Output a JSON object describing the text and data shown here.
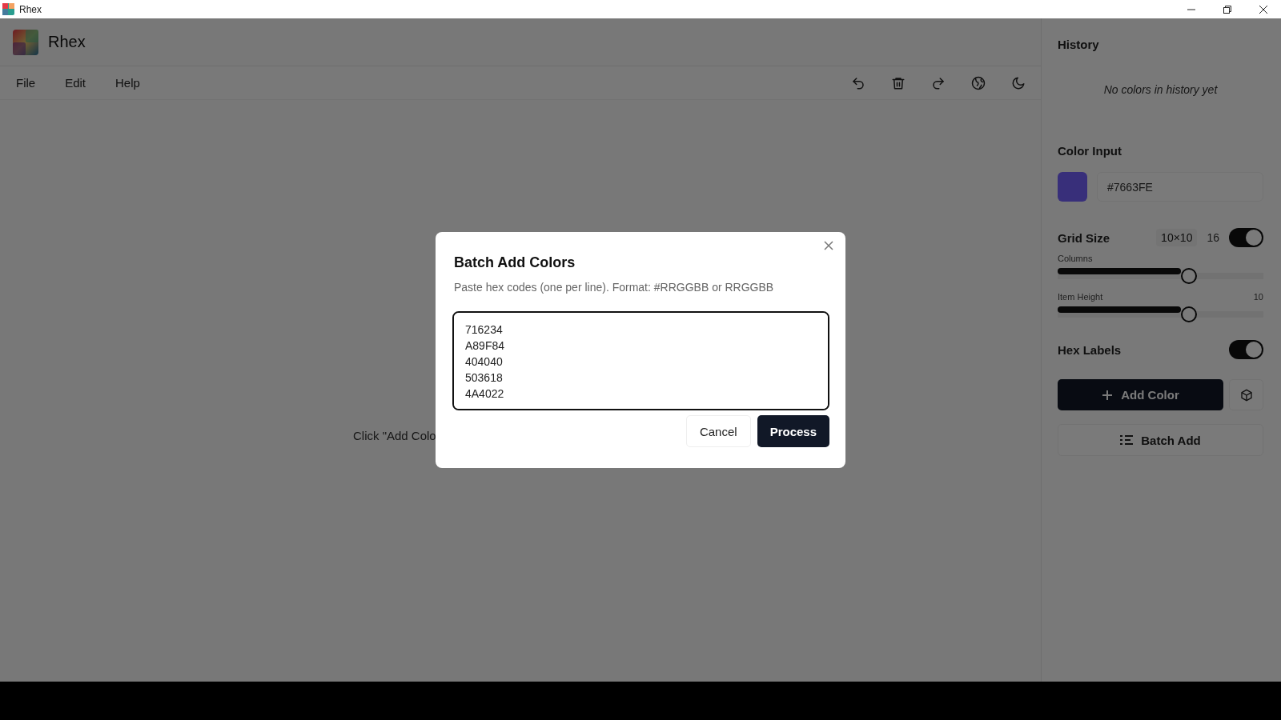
{
  "window": {
    "title": "Rhex"
  },
  "app": {
    "title": "Rhex"
  },
  "menu": [
    {
      "label": "File"
    },
    {
      "label": "Edit"
    },
    {
      "label": "Help"
    }
  ],
  "main": {
    "hint": "Click \"Add Colo"
  },
  "sidebar": {
    "history": {
      "title": "History",
      "empty": "No colors in history yet"
    },
    "color_input": {
      "label": "Color Input",
      "value": "#7663FE"
    },
    "grid_size": {
      "label": "Grid Size",
      "size": "10×10",
      "count": "16",
      "on": true
    },
    "sliders": [
      {
        "label": "Columns",
        "level": 0.6
      },
      {
        "label": "Item Height",
        "reading": "10",
        "level": 0.6
      }
    ],
    "hex_labels": {
      "label": "Hex Labels",
      "on": true
    },
    "add_button": "Add Color",
    "batch_button": "Batch Add"
  },
  "dialog": {
    "title": "Batch Add Colors",
    "description": "Paste hex codes (one per line). Format: #RRGGBB or RRGGBB",
    "value": "716234\nA89F84\n404040\n503618\n4A4022",
    "buttons": [
      {
        "label": "Cancel",
        "kind": "secondary"
      },
      {
        "label": "Process",
        "kind": "primary"
      }
    ]
  }
}
